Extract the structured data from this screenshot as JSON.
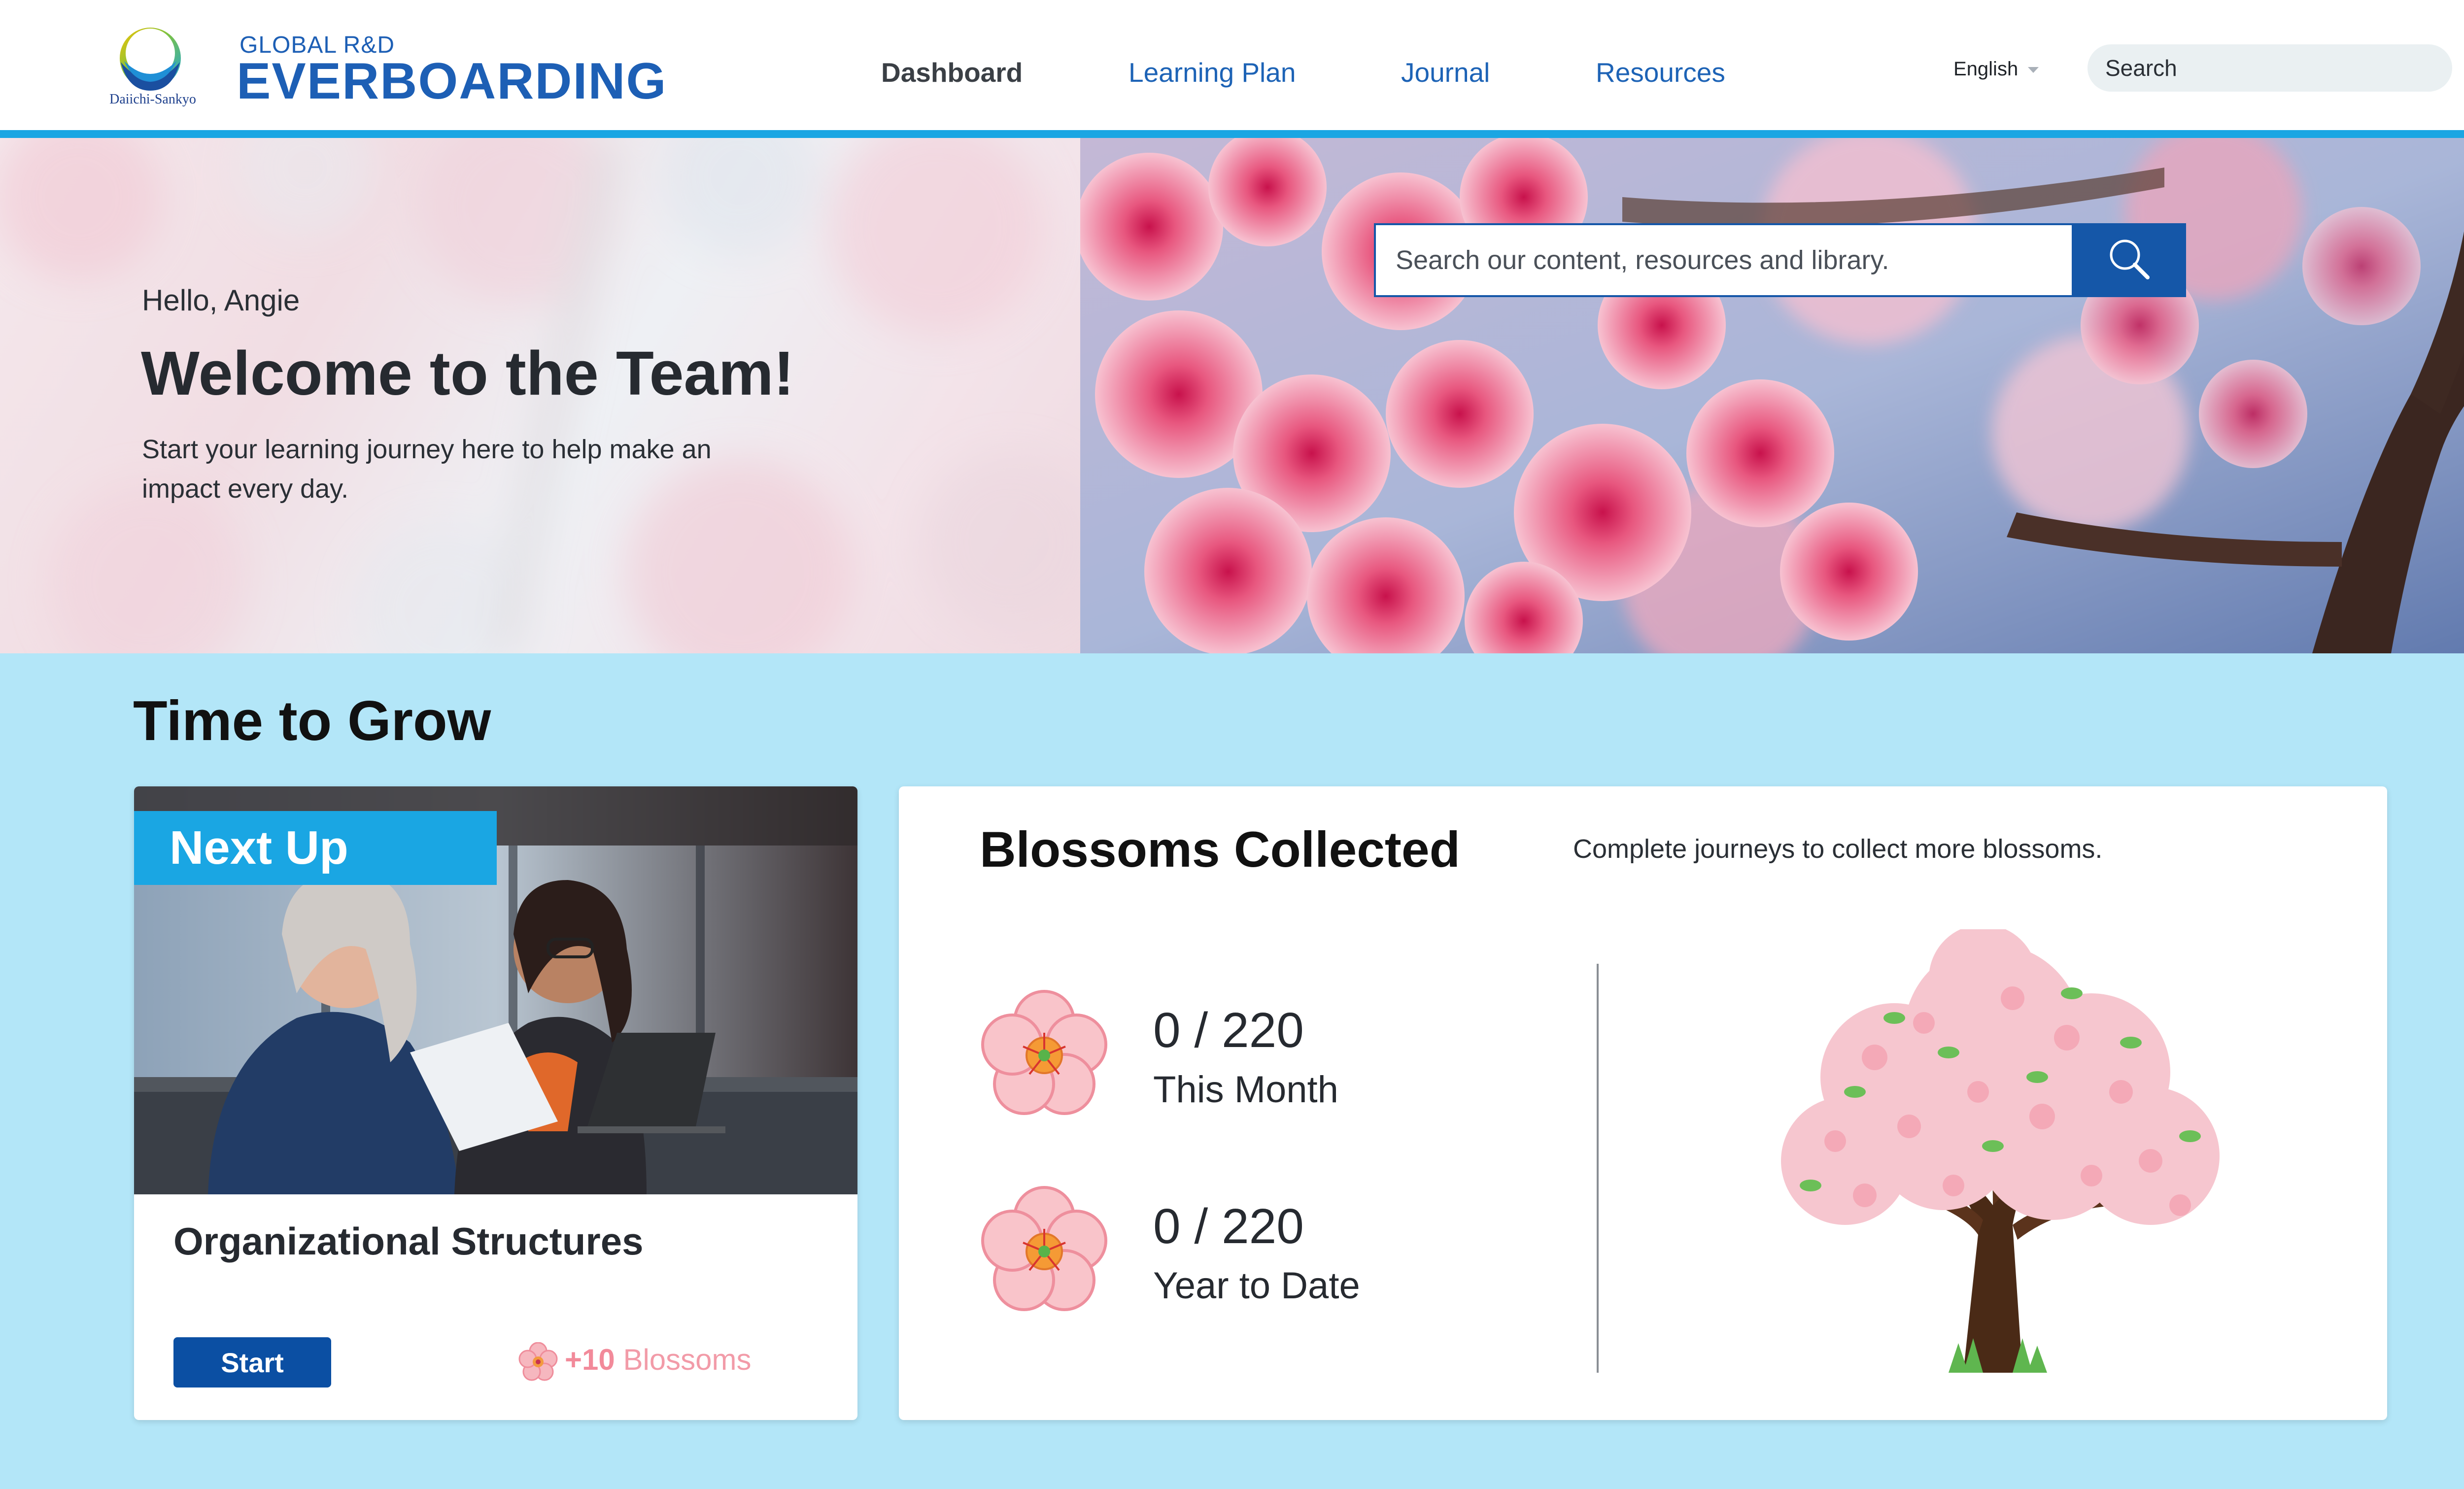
{
  "header": {
    "logo_text": "Daiichi-Sankyo",
    "brand_small": "GLOBAL R&D",
    "brand_big": "EVERBOARDING",
    "nav": [
      {
        "label": "Dashboard",
        "active": true
      },
      {
        "label": "Learning Plan",
        "active": false
      },
      {
        "label": "Journal",
        "active": false
      },
      {
        "label": "Resources",
        "active": false
      }
    ],
    "language": "English",
    "search_placeholder": "Search"
  },
  "hero": {
    "greeting": "Hello, Angie",
    "title": "Welcome to the Team!",
    "subtitle": "Start your learning journey here to help make an impact every day.",
    "search_placeholder": "Search our content, resources and library."
  },
  "section": {
    "title": "Time to Grow"
  },
  "next_up": {
    "badge": "Next Up",
    "course_title": "Organizational Structures",
    "start_label": "Start",
    "reward_amount": "+10",
    "reward_label": "Blossoms"
  },
  "blossoms": {
    "title": "Blossoms Collected",
    "hint": "Complete journeys to collect more blossoms.",
    "stats": [
      {
        "value": "0 / 220",
        "label": "This Month"
      },
      {
        "value": "0 / 220",
        "label": "Year to Date"
      }
    ]
  },
  "colors": {
    "brand_blue": "#1d5fb5",
    "accent_cyan": "#1aa6e3",
    "button_blue": "#0b4fa3",
    "section_bg": "#b3e6f8",
    "blossom_pink": "#f28a9a"
  },
  "icons": [
    "company-logo-icon",
    "chevron-down-icon",
    "magnifier-icon",
    "blossom-icon",
    "cherry-tree-illustration"
  ]
}
